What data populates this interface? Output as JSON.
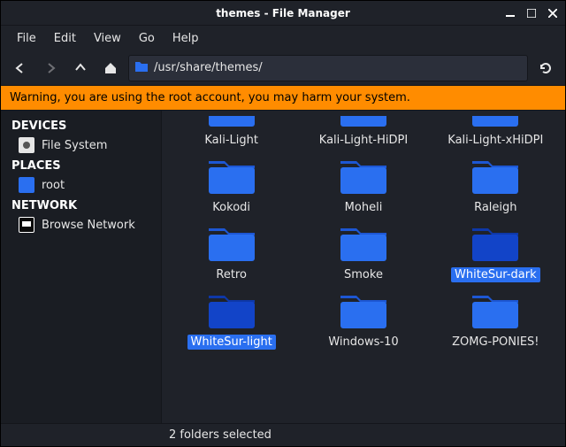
{
  "window": {
    "title": "themes - File Manager"
  },
  "menu": {
    "file": "File",
    "edit": "Edit",
    "view": "View",
    "go": "Go",
    "help": "Help"
  },
  "path": "/usr/share/themes/",
  "warning": "Warning, you are using the root account, you may harm your system.",
  "sidebar": {
    "devices_head": "DEVICES",
    "filesystem": "File System",
    "places_head": "PLACES",
    "root": "root",
    "network_head": "NETWORK",
    "browse_net": "Browse Network"
  },
  "folders": [
    {
      "name": "Kali-Light",
      "selected": false,
      "cut": true
    },
    {
      "name": "Kali-Light-HiDPI",
      "selected": false,
      "cut": true
    },
    {
      "name": "Kali-Light-xHiDPI",
      "selected": false,
      "cut": true
    },
    {
      "name": "Kokodi",
      "selected": false
    },
    {
      "name": "Moheli",
      "selected": false
    },
    {
      "name": "Raleigh",
      "selected": false
    },
    {
      "name": "Retro",
      "selected": false
    },
    {
      "name": "Smoke",
      "selected": false
    },
    {
      "name": "WhiteSur-dark",
      "selected": true
    },
    {
      "name": "WhiteSur-light",
      "selected": true
    },
    {
      "name": "Windows-10",
      "selected": false
    },
    {
      "name": "ZOMG-PONIES!",
      "selected": false
    }
  ],
  "status": "2 folders selected"
}
